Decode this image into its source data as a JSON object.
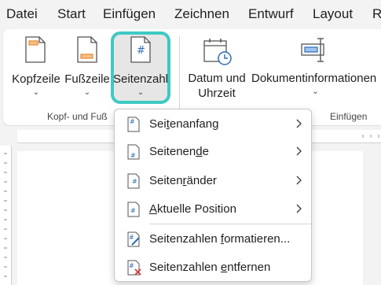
{
  "menubar": {
    "tabs": [
      "Datei",
      "Start",
      "Einfügen",
      "Zeichnen",
      "Entwurf",
      "Layout",
      "R"
    ]
  },
  "ribbon": {
    "buttons": {
      "header": {
        "label": "Kopfzeile"
      },
      "footer": {
        "label": "Fußzeile"
      },
      "page_number": {
        "label": "Seitenzahl"
      },
      "date_time": {
        "label_line1": "Datum und",
        "label_line2": "Uhrzeit"
      },
      "doc_info": {
        "label": "Dokumentinformationen"
      }
    },
    "groups": {
      "header_footer": "Kopf- und Fuß",
      "insert": "Einfügen"
    }
  },
  "dropdown": {
    "items": [
      {
        "pre": "Sei",
        "acc": "t",
        "post": "enanfang",
        "submenu": true
      },
      {
        "pre": "Seitenen",
        "acc": "d",
        "post": "e",
        "submenu": true
      },
      {
        "pre": "Seiten",
        "acc": "r",
        "post": "änder",
        "submenu": true
      },
      {
        "pre": "",
        "acc": "A",
        "post": "ktuelle Position",
        "submenu": true
      },
      {
        "pre": "Seitenzahlen ",
        "acc": "f",
        "post": "ormatieren...",
        "submenu": false
      },
      {
        "pre": "Seitenzahlen ",
        "acc": "e",
        "post": "ntfernen",
        "submenu": false
      }
    ]
  },
  "colors": {
    "accent_outline": "#3fc9c3",
    "icon_orange": "#e38a2c",
    "icon_blue": "#2b6cb5",
    "remove_red": "#d13438"
  }
}
